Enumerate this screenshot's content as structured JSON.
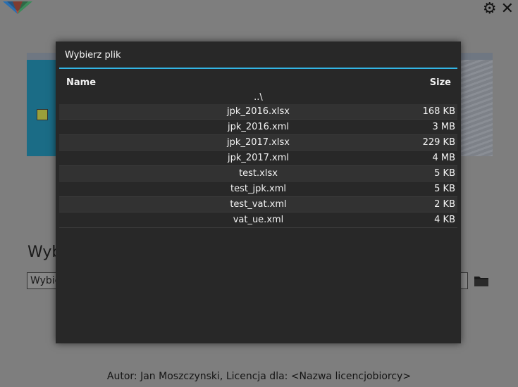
{
  "background": {
    "heading_partial": "Wyb",
    "input_partial": "Wybie",
    "footer": "Autor: Jan Moszczynski, Licencja dla: <Nazwa licencjobiorcy>"
  },
  "dialog": {
    "title": "Wybierz plik",
    "columns": {
      "name": "Name",
      "size": "Size"
    },
    "parent_dir": "..\\",
    "files": [
      {
        "name": "jpk_2016.xlsx",
        "size": "168 KB"
      },
      {
        "name": "jpk_2016.xml",
        "size": "3 MB"
      },
      {
        "name": "jpk_2017.xlsx",
        "size": "229 KB"
      },
      {
        "name": "jpk_2017.xml",
        "size": "4 MB"
      },
      {
        "name": "test.xlsx",
        "size": "5 KB"
      },
      {
        "name": "test_jpk.xml",
        "size": "5 KB"
      },
      {
        "name": "test_vat.xml",
        "size": "2 KB"
      },
      {
        "name": "vat_ue.xml",
        "size": "4 KB"
      }
    ]
  },
  "icons": {
    "logo": "app-logo",
    "settings": "gear-icon",
    "close": "close-icon",
    "folder": "folder-icon"
  },
  "colors": {
    "accent": "#33b5e5",
    "dialog_bg": "#282828",
    "overlay_bg": "#7e7e7e"
  }
}
